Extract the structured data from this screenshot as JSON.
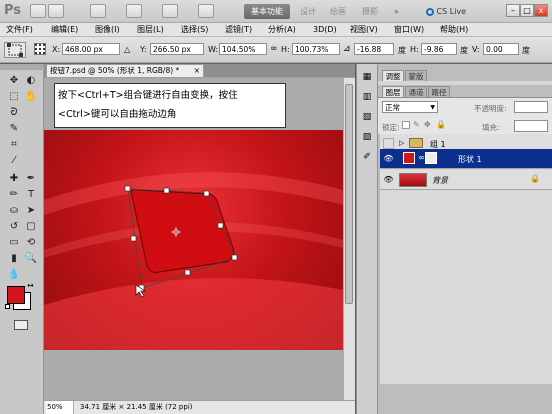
{
  "app": {
    "logo": "Ps",
    "workspaces": [
      "基本功能",
      "设计",
      "绘画",
      "摄影"
    ],
    "extras_label": "»",
    "cs_live": "CS Live"
  },
  "window_buttons": {
    "minimize": "–",
    "restore": "□",
    "close": "x"
  },
  "menu": [
    "文件(F)",
    "编辑(E)",
    "图像(I)",
    "图层(L)",
    "选择(S)",
    "滤镜(T)",
    "分析(A)",
    "3D(D)",
    "视图(V)",
    "窗口(W)",
    "帮助(H)"
  ],
  "options": {
    "x_label": "X:",
    "x_value": "468.00 px",
    "y_label": "Y:",
    "y_value": "266.50 px",
    "w_label": "W:",
    "w_value": "104.50%",
    "h_label": "H:",
    "h_value": "100.73%",
    "angle_value": "-16.88",
    "angle_unit": "度",
    "hskew_label": "H:",
    "hskew_value": "-9.86",
    "hskew_unit": "度",
    "vskew_label": "V:",
    "vskew_value": "0.00",
    "vskew_unit": "度"
  },
  "document": {
    "tab_title": "按钮7.psd @ 50% (形状 1, RGB/8) *",
    "tab_close": "×",
    "zoom": "50%",
    "doc_info": "34.71 厘米 × 21.45 厘米 (72 ppi)"
  },
  "instruction": {
    "line1": "按下<Ctrl+T>组合键进行自由变换，按住",
    "line2": "<Ctrl>键可以自由拖动边角"
  },
  "panels": {
    "top_tabs": [
      "调整",
      "蒙版"
    ],
    "layer_tabs": [
      "图层",
      "通道",
      "路径"
    ],
    "blend_mode": "正常",
    "opacity_label": "不透明度:",
    "lock_label": "锁定:",
    "fill_label": "填充:"
  },
  "layers": [
    {
      "name": "组 1",
      "type": "group"
    },
    {
      "name": "形状 1",
      "type": "shape",
      "selected": true
    },
    {
      "name": "背景",
      "type": "background"
    }
  ],
  "colors": {
    "foreground": "#d4161c",
    "background": "#ffffff",
    "selected_layer": "#0b2f8c"
  }
}
